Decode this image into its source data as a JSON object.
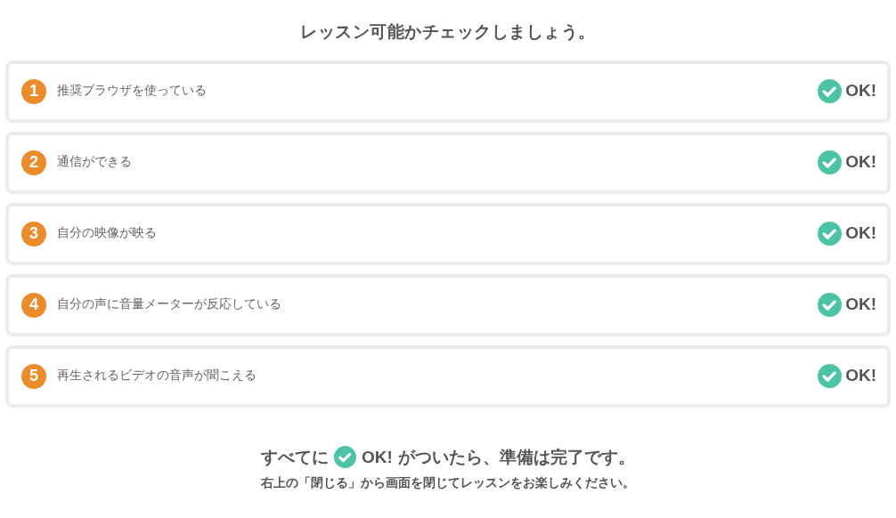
{
  "title": "レッスン可能かチェックしましょう。",
  "checks": [
    {
      "number": "1",
      "label": "推奨ブラウザを使っている",
      "ok": true,
      "status": "OK!"
    },
    {
      "number": "2",
      "label": "通信ができる",
      "ok": true,
      "status": "OK!"
    },
    {
      "number": "3",
      "label": "自分の映像が映る",
      "ok": true,
      "status": "OK!"
    },
    {
      "number": "4",
      "label": "自分の声に音量メーターが反応している",
      "ok": true,
      "status": "OK!"
    },
    {
      "number": "5",
      "label": "再生されるビデオの音声が聞こえる",
      "ok": true,
      "status": "OK!"
    }
  ],
  "footer": {
    "before": "すべてに",
    "ok_label": "OK!",
    "after": "がついたら、準備は完了です。",
    "note": "右上の「閉じる」から画面を閉じてレッスンをお楽しみください。"
  }
}
